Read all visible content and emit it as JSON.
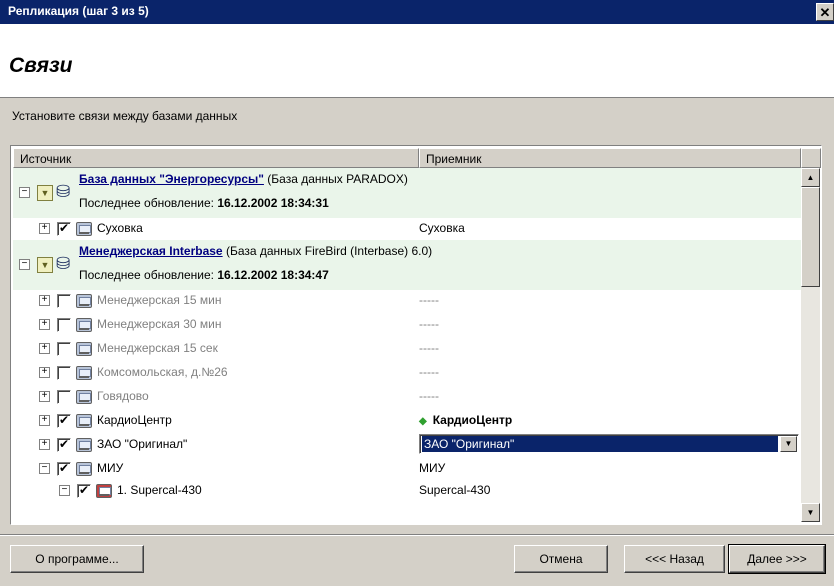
{
  "window": {
    "title": "Репликация (шаг 3 из 5)",
    "close_glyph": "✕"
  },
  "header": {
    "heading": "Связи"
  },
  "instruction": "Установите связи между базами данных",
  "columns": {
    "source": "Источник",
    "target": "Приемник"
  },
  "groups": [
    {
      "name": "База данных \"Энергоресурсы\"",
      "type": "(База данных PARADOX)",
      "updated_label": "Последнее обновление:",
      "updated_value": "16.12.2002 18:34:31"
    },
    {
      "name": "Менеджерская Interbase",
      "type": "(База данных FireBird (Interbase) 6.0)",
      "updated_label": "Последнее обновление:",
      "updated_value": "16.12.2002 18:34:47"
    }
  ],
  "rows": [
    {
      "label": "Суховка",
      "target": "Суховка"
    },
    {
      "label": "Менеджерская 15 мин",
      "target": "-----"
    },
    {
      "label": "Менеджерская 30 мин",
      "target": "-----"
    },
    {
      "label": "Менеджерская 15 сек",
      "target": "-----"
    },
    {
      "label": "Комсомольская, д.№26",
      "target": "-----"
    },
    {
      "label": "Говядово",
      "target": "-----"
    },
    {
      "label": "КардиоЦентр",
      "target": "КардиоЦентр"
    },
    {
      "label": "ЗАО \"Оригинал\"",
      "target": "ЗАО \"Оригинал\""
    },
    {
      "label": "МИУ",
      "target": "МИУ"
    },
    {
      "label": "1. Supercal-430",
      "target": "Supercal-430"
    }
  ],
  "buttons": {
    "about": "О программе...",
    "cancel": "Отмена",
    "back": "<<< Назад",
    "next": "Далее >>>"
  },
  "colors": {
    "titlebar": "#0a246a",
    "group_bg": "#eaf5ea",
    "selection": "#0a246a"
  }
}
